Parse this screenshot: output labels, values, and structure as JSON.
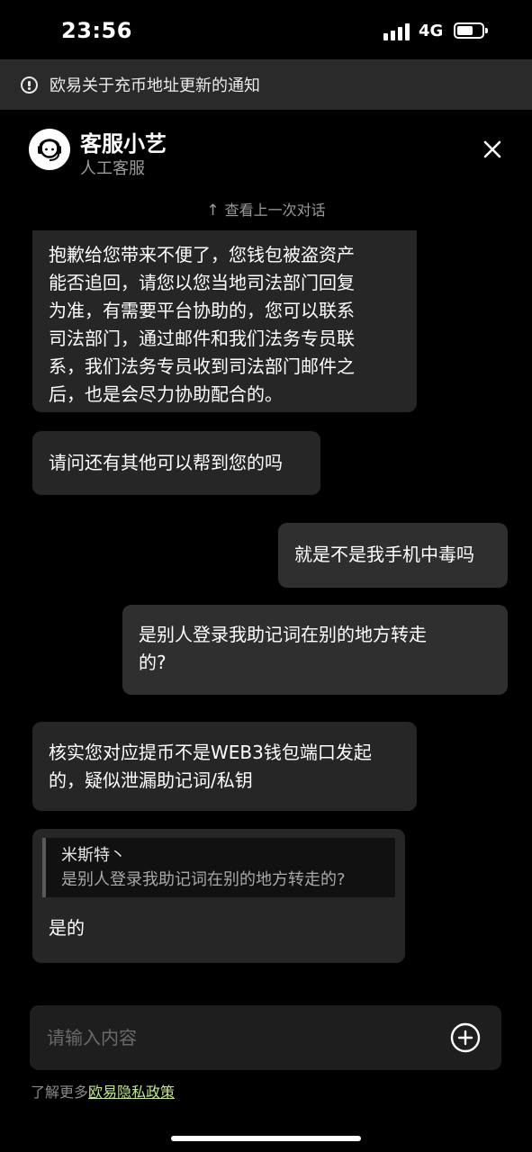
{
  "status_bar": {
    "time": "23:56",
    "network": "4G",
    "signal_icon": "signal-bars-icon",
    "battery_icon": "battery-icon"
  },
  "notice": {
    "icon": "info-circle-icon",
    "text": "欧易关于充币地址更新的通知"
  },
  "header": {
    "avatar_icon": "headset-agent-icon",
    "agent_name": "客服小艺",
    "agent_role": "人工客服",
    "close_icon": "close-icon"
  },
  "history_link": {
    "icon": "up-arrow-icon",
    "arrow": "↑",
    "label": "查看上一次对话"
  },
  "messages": [
    {
      "sender": "agent",
      "lines": [
        "抱歉给您带来不便了，您钱包被盗资产",
        "能否追回，请您以您当地司法部门回复",
        "为准，有需要平台协助的，您可以联系",
        "司法部门，通过邮件和我们法务专员联",
        "系，我们法务专员收到司法部门邮件之",
        "后，也是会尽力协助配合的。"
      ]
    },
    {
      "sender": "agent",
      "lines": [
        "请问还有其他可以帮到您的吗"
      ]
    },
    {
      "sender": "user",
      "lines": [
        "就是不是我手机中毒吗"
      ]
    },
    {
      "sender": "user",
      "lines": [
        "是别人登录我助记词在别的地方转走",
        "的?"
      ]
    },
    {
      "sender": "agent",
      "lines": [
        "核实您对应提币不是WEB3钱包端口发起",
        "的，疑似泄漏助记词/私钥"
      ]
    },
    {
      "sender": "agent",
      "quote": {
        "author": "米斯特丶",
        "text": "是别人登录我助记词在别的地方转走的?"
      },
      "lines": [
        "是的"
      ]
    }
  ],
  "input": {
    "placeholder": "请输入内容",
    "add_icon": "plus-circle-icon"
  },
  "privacy": {
    "prefix": "了解更多",
    "link_label": "欧易隐私政策"
  }
}
